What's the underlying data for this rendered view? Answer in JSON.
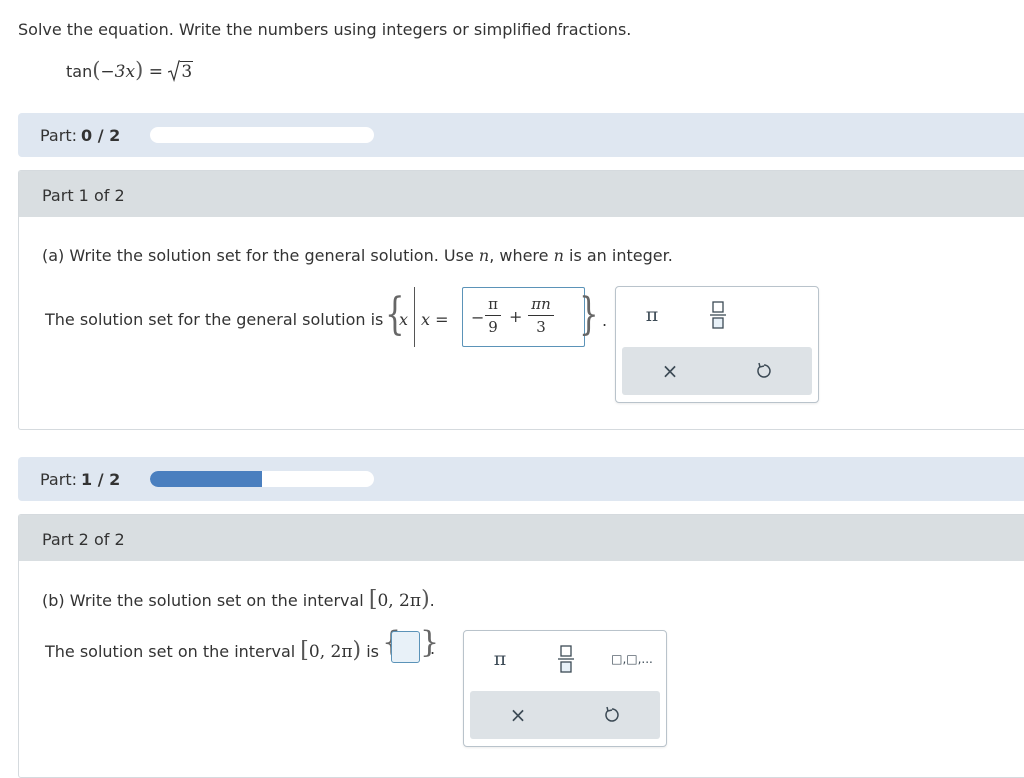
{
  "instruction": "Solve the equation. Write the numbers using integers or simplified fractions.",
  "equation": {
    "fn": "tan",
    "arg": "−3x",
    "rhs_radicand": "3"
  },
  "part_status_1": {
    "label": "Part:",
    "value": "0 / 2",
    "progress": 0.0
  },
  "part1": {
    "header": "Part 1 of 2",
    "question_prefix": "(a) Write the solution set for the general solution. Use",
    "question_var": "n",
    "question_mid": ", where",
    "question_var2": "n",
    "question_suffix": "is an integer.",
    "answer_prefix": "The solution set for the general solution is",
    "set_var": "x",
    "set_cond": "x =",
    "answer": {
      "sign": "−",
      "frac1_num": "π",
      "frac1_den": "9",
      "op": "+",
      "frac2_num": "πn",
      "frac2_den": "3"
    },
    "palette": {
      "pi": "π",
      "clear": "×"
    }
  },
  "part_status_2": {
    "label": "Part:",
    "value": "1 / 2",
    "progress": 0.5
  },
  "part2": {
    "header": "Part 2 of 2",
    "question_prefix": "(b) Write the solution set on the interval",
    "interval": "0, 2π",
    "answer_prefix": "The solution set on the interval",
    "answer_mid": "is",
    "palette": {
      "pi": "π",
      "clear": "×",
      "list": "□,□,..."
    }
  },
  "colors": {
    "accent": "#4a7fbf",
    "part_bar_bg": "#dfe7f1",
    "header_bg": "#d9dee1",
    "input_border": "#5b93b8"
  },
  "icons": [
    "fraction-icon",
    "undo-icon",
    "list-icon"
  ]
}
